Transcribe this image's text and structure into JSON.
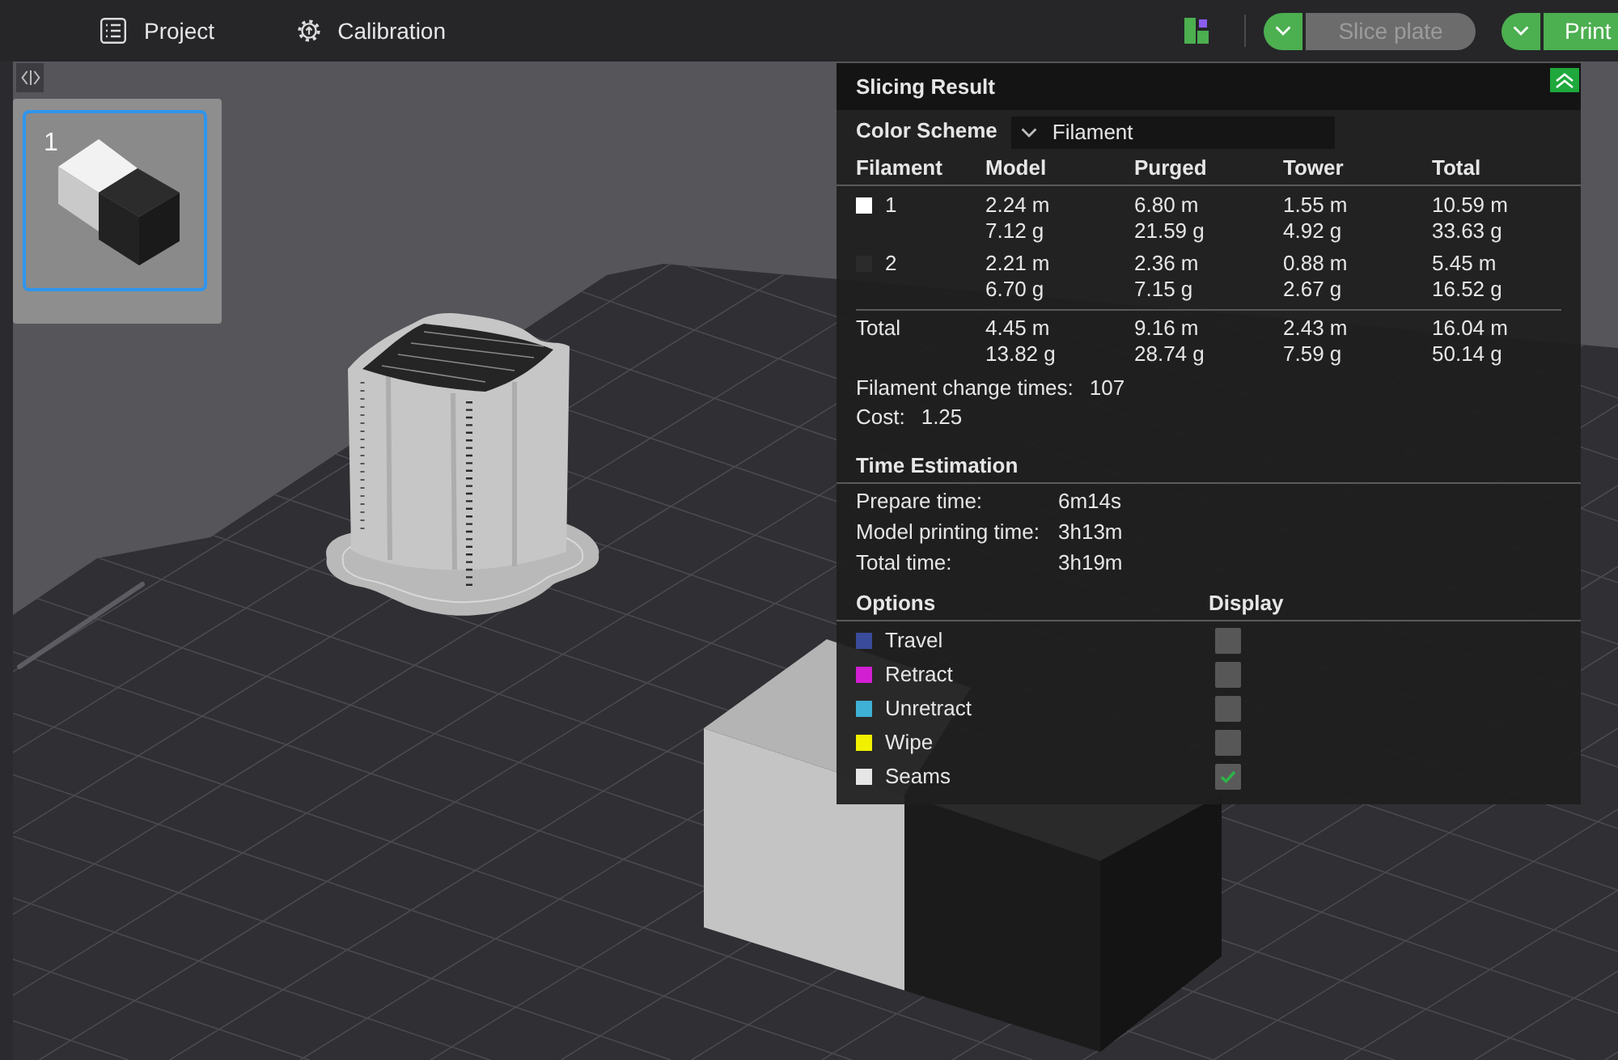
{
  "toolbar": {
    "menu": [
      {
        "label": "Project"
      },
      {
        "label": "Calibration"
      }
    ],
    "slice_button": {
      "label": "Slice plate",
      "disabled": true
    },
    "print_button": {
      "label": "Print",
      "disabled": false
    }
  },
  "plates": [
    {
      "label": "1",
      "selected": true
    }
  ],
  "slicing_result": {
    "title": "Slicing Result",
    "color_scheme": {
      "label": "Color Scheme",
      "value": "Filament"
    },
    "filament_table": {
      "columns": [
        "Filament",
        "Model",
        "Purged",
        "Tower",
        "Total"
      ],
      "rows": [
        {
          "filament": "1",
          "color": "#ffffff",
          "values": [
            [
              "2.24 m",
              "7.12 g"
            ],
            [
              "6.80 m",
              "21.59 g"
            ],
            [
              "1.55 m",
              "4.92 g"
            ],
            [
              "10.59 m",
              "33.63 g"
            ]
          ]
        },
        {
          "filament": "2",
          "color": "#2b2b2b",
          "values": [
            [
              "2.21 m",
              "6.70 g"
            ],
            [
              "2.36 m",
              "7.15 g"
            ],
            [
              "0.88 m",
              "2.67 g"
            ],
            [
              "5.45 m",
              "16.52 g"
            ]
          ]
        }
      ],
      "total": {
        "label": "Total",
        "values": [
          [
            "4.45 m",
            "13.82 g"
          ],
          [
            "9.16 m",
            "28.74 g"
          ],
          [
            "2.43 m",
            "7.59 g"
          ],
          [
            "16.04 m",
            "50.14 g"
          ]
        ]
      }
    },
    "stats": [
      {
        "label": "Filament change times:",
        "value": "107"
      },
      {
        "label": "Cost:",
        "value": "1.25"
      }
    ],
    "time_estimation": {
      "title": "Time Estimation",
      "rows": [
        {
          "label": "Prepare time:",
          "value": "6m14s"
        },
        {
          "label": "Model printing time:",
          "value": "3h13m"
        },
        {
          "label": "Total time:",
          "value": "3h19m"
        }
      ]
    },
    "options": {
      "columns": [
        "Options",
        "Display"
      ],
      "items": [
        {
          "label": "Travel",
          "color": "#3b4b9c",
          "checked": false
        },
        {
          "label": "Retract",
          "color": "#d21fd2",
          "checked": false
        },
        {
          "label": "Unretract",
          "color": "#3fb0d6",
          "checked": false
        },
        {
          "label": "Wipe",
          "color": "#f0f000",
          "checked": false
        },
        {
          "label": "Seams",
          "color": "#e6e6e6",
          "checked": true
        }
      ]
    }
  }
}
